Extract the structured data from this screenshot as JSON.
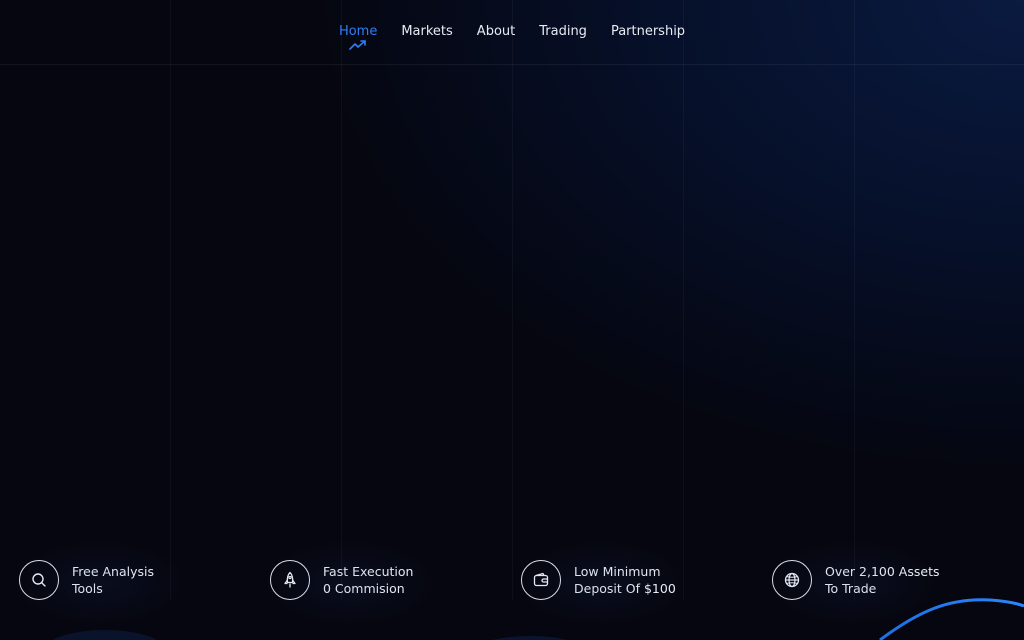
{
  "nav": {
    "items": [
      {
        "label": "Home",
        "active": true
      },
      {
        "label": "Markets",
        "active": false
      },
      {
        "label": "About",
        "active": false
      },
      {
        "label": "Trading",
        "active": false
      },
      {
        "label": "Partnership",
        "active": false
      }
    ],
    "active_icon": "trend-up-icon"
  },
  "features": [
    {
      "icon": "search-icon",
      "line1": "Free Analysis",
      "line2": "Tools"
    },
    {
      "icon": "rocket-icon",
      "line1": "Fast Execution",
      "line2": "0 Commision"
    },
    {
      "icon": "wallet-icon",
      "line1": "Low Minimum",
      "line2": "Deposit Of $100"
    },
    {
      "icon": "globe-icon",
      "line1": "Over 2,100 Assets",
      "line2": "To Trade"
    }
  ],
  "colors": {
    "accent": "#2f7df6",
    "background": "#05060f",
    "text": "#e8ebf3"
  }
}
